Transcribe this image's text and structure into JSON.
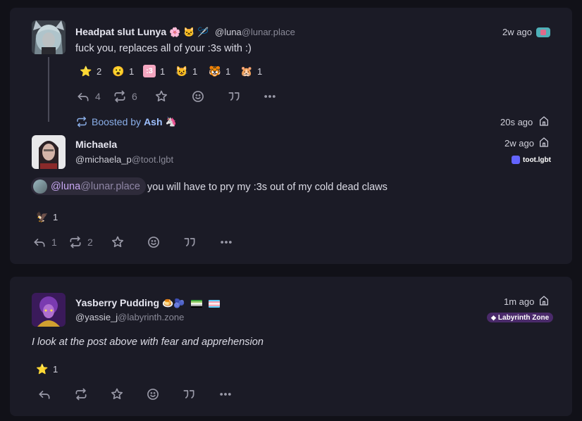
{
  "post1": {
    "display_name": "Headpat slut Lunya",
    "name_emojis": [
      "🌸",
      "🐱",
      "🪡"
    ],
    "handle_user": "@luna",
    "handle_domain": "@lunar.place",
    "time": "2w ago",
    "content": "fuck you, replaces all of your :3s with :)",
    "reactions": [
      {
        "emoji": "⭐",
        "count": "2"
      },
      {
        "emoji": "😮",
        "count": "1"
      },
      {
        "emoji": ":3",
        "count": "1"
      },
      {
        "emoji": "😺",
        "count": "1"
      },
      {
        "emoji": "🐯",
        "count": "1"
      },
      {
        "emoji": "🐹",
        "count": "1"
      }
    ],
    "actions": {
      "reply_count": "4",
      "boost_count": "6"
    }
  },
  "boost": {
    "label": "Boosted by",
    "booster": "Ash",
    "booster_emoji": "🦄",
    "time": "20s ago"
  },
  "post2": {
    "display_name": "Michaela",
    "handle_user": "@michaela_p",
    "handle_domain": "@toot.lgbt",
    "time": "2w ago",
    "instance": "toot.lgbt",
    "mention_user": "@luna",
    "mention_domain": "@lunar.place",
    "content": "you will have to pry my :3s out of my cold dead claws",
    "reactions": [
      {
        "emoji": "🦅",
        "count": "1"
      }
    ],
    "actions": {
      "reply_count": "1",
      "boost_count": "2"
    }
  },
  "post3": {
    "display_name": "Yasberry Pudding",
    "name_emojis": [
      "🍮",
      "🫐"
    ],
    "handle_user": "@yassie_j",
    "handle_domain": "@labyrinth.zone",
    "time": "1m ago",
    "instance": "Labyrinth Zone",
    "content": "I look at the post above with fear and apprehension",
    "reactions": [
      {
        "emoji": "⭐",
        "count": "1"
      }
    ]
  },
  "colors": {
    "background": "#111118",
    "card": "#1b1b26",
    "accent_boost": "#8aaee8",
    "mention": "#c7a7f2",
    "toot_badge": "#6364ff",
    "labyrinth_badge": "#4a2a6a"
  }
}
